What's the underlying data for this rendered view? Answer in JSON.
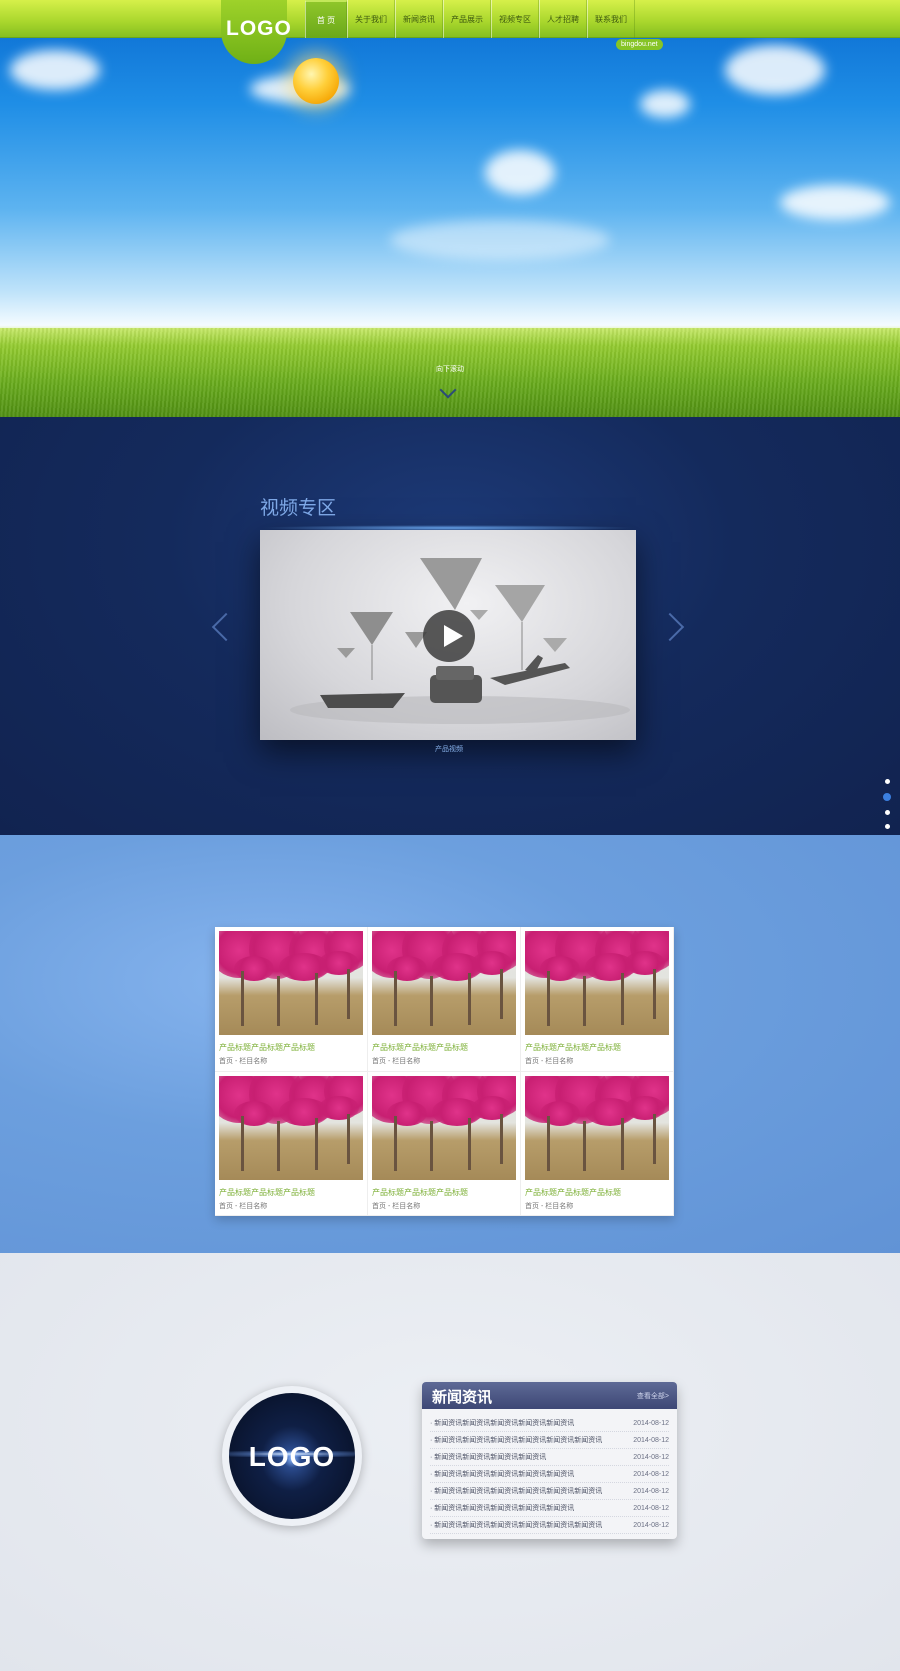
{
  "header": {
    "logo": "LOGO",
    "nav": [
      "首 页",
      "关于我们",
      "新闻资讯",
      "产品展示",
      "视频专区",
      "人才招聘",
      "联系我们"
    ],
    "site_tag": "bingdou.net"
  },
  "hero": {
    "scroll_label": "向下滚动"
  },
  "video": {
    "title": "视频专区",
    "caption": "产品视频"
  },
  "products": {
    "items": [
      {
        "title": "产品标题产品标题产品标题",
        "meta": "首页 - 栏目名称"
      },
      {
        "title": "产品标题产品标题产品标题",
        "meta": "首页 - 栏目名称"
      },
      {
        "title": "产品标题产品标题产品标题",
        "meta": "首页 - 栏目名称"
      },
      {
        "title": "产品标题产品标题产品标题",
        "meta": "首页 - 栏目名称"
      },
      {
        "title": "产品标题产品标题产品标题",
        "meta": "首页 - 栏目名称"
      },
      {
        "title": "产品标题产品标题产品标题",
        "meta": "首页 - 栏目名称"
      }
    ]
  },
  "about": {
    "logo": "LOGO"
  },
  "news": {
    "title": "新闻资讯",
    "more": "查看全部>",
    "items": [
      {
        "title": "· 新闻资讯新闻资讯新闻资讯新闻资讯新闻资讯",
        "date": "2014-08-12"
      },
      {
        "title": "· 新闻资讯新闻资讯新闻资讯新闻资讯新闻资讯新闻资讯",
        "date": "2014-08-12"
      },
      {
        "title": "· 新闻资讯新闻资讯新闻资讯新闻资讯",
        "date": "2014-08-12"
      },
      {
        "title": "· 新闻资讯新闻资讯新闻资讯新闻资讯新闻资讯",
        "date": "2014-08-12"
      },
      {
        "title": "· 新闻资讯新闻资讯新闻资讯新闻资讯新闻资讯新闻资讯",
        "date": "2014-08-12"
      },
      {
        "title": "· 新闻资讯新闻资讯新闻资讯新闻资讯新闻资讯",
        "date": "2014-08-12"
      },
      {
        "title": "· 新闻资讯新闻资讯新闻资讯新闻资讯新闻资讯新闻资讯",
        "date": "2014-08-12"
      }
    ]
  }
}
